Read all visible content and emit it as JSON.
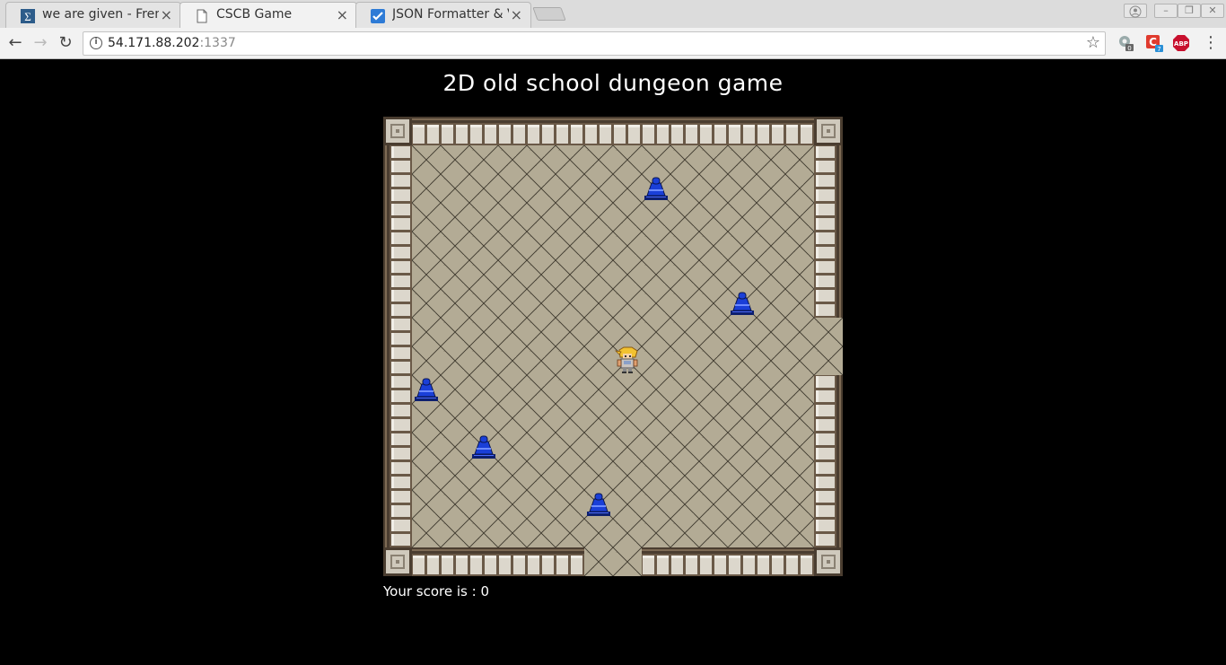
{
  "browser": {
    "tabs": [
      {
        "title": "we are given - Frenc",
        "icon": "latex-icon"
      },
      {
        "title": "CSCB Game",
        "icon": "page-icon"
      },
      {
        "title": "JSON Formatter & V",
        "icon": "checkbox-icon"
      }
    ],
    "active_tab": 1,
    "url_host": "54.171.88.202",
    "url_port": ":1337",
    "extensions": [
      {
        "icon": "extension-gear-icon",
        "badge": "0"
      },
      {
        "icon": "extension-c-icon",
        "badge": "7"
      },
      {
        "icon": "adblock-icon",
        "label": "ABP"
      }
    ]
  },
  "game": {
    "title": "2D old school dungeon game",
    "score_label": "Your score is : ",
    "score": "0",
    "grid_size": 16,
    "player": {
      "col": 8,
      "row": 8
    },
    "enemies": [
      {
        "col": 9,
        "row": 2
      },
      {
        "col": 12,
        "row": 6
      },
      {
        "col": 1,
        "row": 9
      },
      {
        "col": 3,
        "row": 11
      },
      {
        "col": 7,
        "row": 13
      }
    ],
    "exits": [
      {
        "side": "right",
        "rows": [
          7,
          8
        ]
      },
      {
        "side": "bottom",
        "cols": [
          7,
          8
        ]
      }
    ],
    "colors": {
      "floor": "#b3ab95",
      "wall": "#d7d2c8",
      "wall_dark": "#5b4a3a",
      "enemy": "#1a3fd8",
      "text": "#ffffff"
    }
  }
}
